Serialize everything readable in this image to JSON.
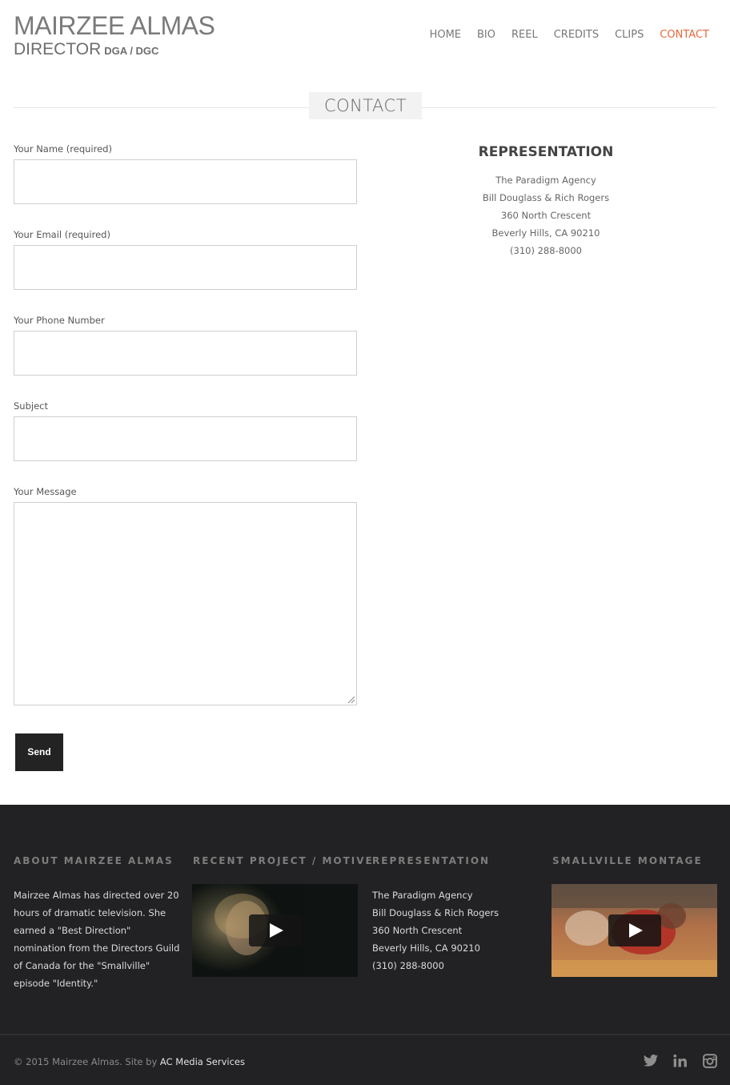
{
  "header": {
    "logo_name": "MAIRZEE ALMAS",
    "logo_role": "DIRECTOR",
    "logo_guild": "DGA / DGC"
  },
  "nav": {
    "items": [
      "HOME",
      "BIO",
      "REEL",
      "CREDITS",
      "CLIPS",
      "CONTACT"
    ],
    "active": "CONTACT",
    "active_color": "#e8673a"
  },
  "page": {
    "title": "CONTACT"
  },
  "form": {
    "name_label": "Your Name (required)",
    "email_label": "Your Email (required)",
    "phone_label": "Your Phone Number",
    "subject_label": "Subject",
    "message_label": "Your Message",
    "send_label": "Send"
  },
  "representation": {
    "heading": "REPRESENTATION",
    "lines": [
      "The Paradigm Agency",
      "Bill Douglass & Rich Rogers",
      "360 North Crescent",
      "Beverly Hills, CA 90210",
      "(310) 288-8000"
    ]
  },
  "footer": {
    "about_heading": "ABOUT MAIRZEE ALMAS",
    "about_text": "Mairzee Almas has directed over 20 hours of dramatic television. She earned a \"Best Direction\" nomination from the Directors Guild of Canada for the \"Smallville\" episode \"Identity.\"",
    "recent_heading": "RECENT PROJECT / MOTIVE",
    "rep_heading": "REPRESENTATION",
    "rep_lines": [
      "The Paradigm Agency",
      "Bill Douglass & Rich Rogers",
      "360 North Crescent",
      "Beverly Hills, CA 90210",
      "(310) 288-8000"
    ],
    "montage_heading": "SMALLVILLE MONTAGE",
    "copyright_text": "© 2015 Mairzee Almas. Site by ",
    "credit_link": "AC Media Services",
    "social_icons": [
      "twitter-icon",
      "linkedin-icon",
      "instagram-icon"
    ]
  }
}
